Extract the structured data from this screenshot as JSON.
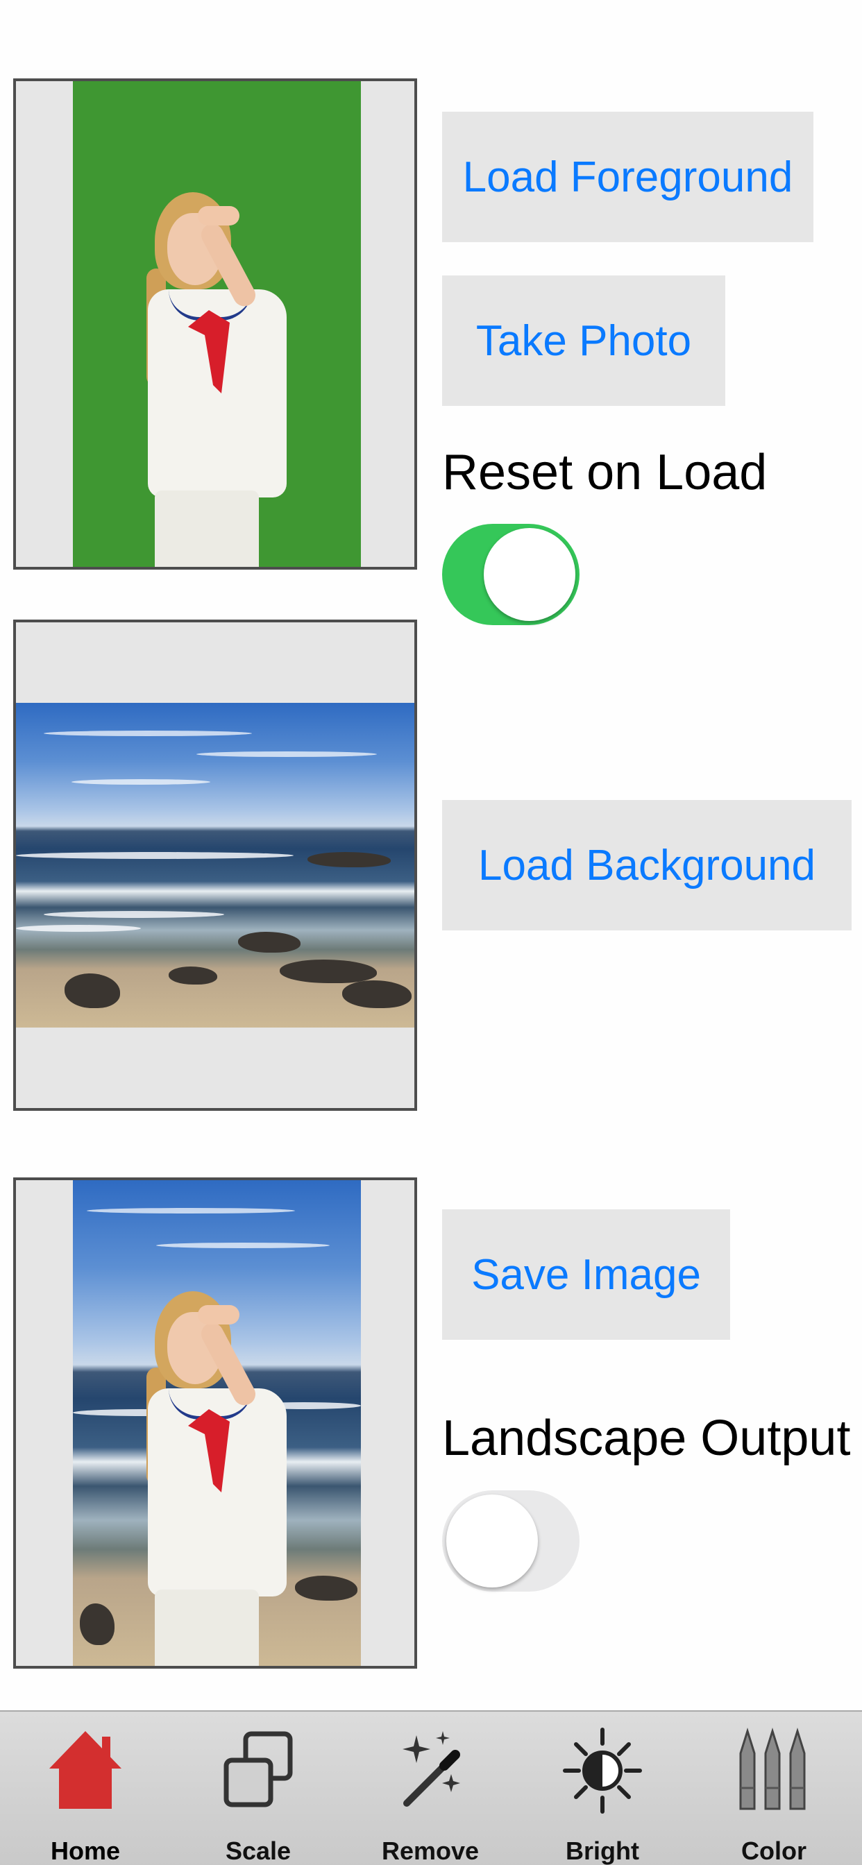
{
  "buttons": {
    "load_foreground": "Load Foreground",
    "take_photo": "Take Photo",
    "load_background": "Load Background",
    "save_image": "Save Image"
  },
  "toggles": {
    "reset_on_load": {
      "label": "Reset on Load",
      "on": true
    },
    "landscape_output": {
      "label": "Landscape Output",
      "on": false
    }
  },
  "tabbar": {
    "items": [
      {
        "label": "Home",
        "icon": "home-icon",
        "active": true
      },
      {
        "label": "Scale",
        "icon": "scale-icon"
      },
      {
        "label": "Remove",
        "icon": "magic-wand-icon"
      },
      {
        "label": "Bright",
        "icon": "brightness-icon"
      },
      {
        "label": "Color",
        "icon": "crayons-icon"
      }
    ]
  },
  "colors": {
    "accent": "#0a7aff",
    "toggle_on": "#35c759",
    "home_icon": "#d32f2f"
  }
}
